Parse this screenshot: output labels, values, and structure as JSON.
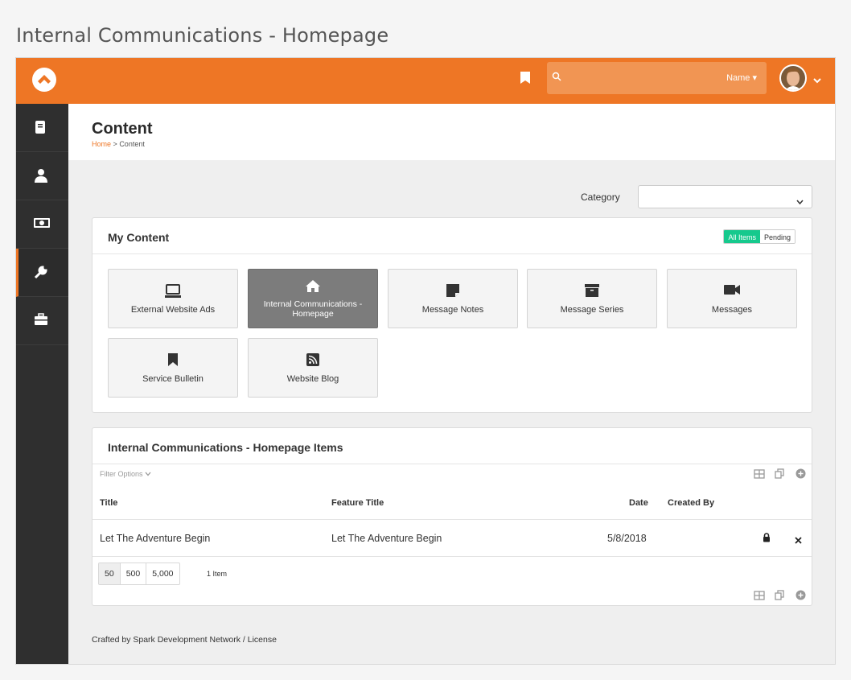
{
  "page": {
    "outer_title": "Internal Communications - Homepage"
  },
  "topbar": {
    "search_placeholder": "",
    "search_filter_label": "Name ▾",
    "colors": {
      "bar": "#ee7625",
      "search": "#f19553"
    }
  },
  "sidebar": {
    "items": [
      {
        "icon": "book-icon"
      },
      {
        "icon": "person-icon"
      },
      {
        "icon": "money-icon"
      },
      {
        "icon": "wrench-icon",
        "active": true
      },
      {
        "icon": "briefcase-icon"
      }
    ]
  },
  "header": {
    "title": "Content",
    "breadcrumb": {
      "home": "Home",
      "separator": ">",
      "current": "Content"
    }
  },
  "filter": {
    "category_label": "Category",
    "category_value": ""
  },
  "my_content": {
    "title": "My Content",
    "toggle": {
      "all": "All Items",
      "pending": "Pending"
    },
    "tiles": [
      {
        "label": "External Website Ads",
        "icon": "laptop-icon"
      },
      {
        "label": "Internal Communications - Homepage",
        "icon": "home-icon",
        "selected": true
      },
      {
        "label": "Message Notes",
        "icon": "sticky-note-icon"
      },
      {
        "label": "Message Series",
        "icon": "archive-icon"
      },
      {
        "label": "Messages",
        "icon": "video-camera-icon"
      },
      {
        "label": "Service Bulletin",
        "icon": "bookmark-icon"
      },
      {
        "label": "Website Blog",
        "icon": "rss-icon"
      }
    ]
  },
  "items_panel": {
    "title": "Internal Communications - Homepage Items",
    "filter_options": "Filter Options",
    "columns": {
      "title": "Title",
      "feature_title": "Feature Title",
      "date": "Date",
      "created_by": "Created By"
    },
    "rows": [
      {
        "title": "Let The Adventure Begin",
        "feature_title": "Let The Adventure Begin",
        "date": "5/8/2018",
        "created_by": ""
      }
    ],
    "page_sizes": [
      "50",
      "500",
      "5,000"
    ],
    "item_count": "1 Item"
  },
  "footer": {
    "text": "Crafted by Spark Development Network / License"
  }
}
